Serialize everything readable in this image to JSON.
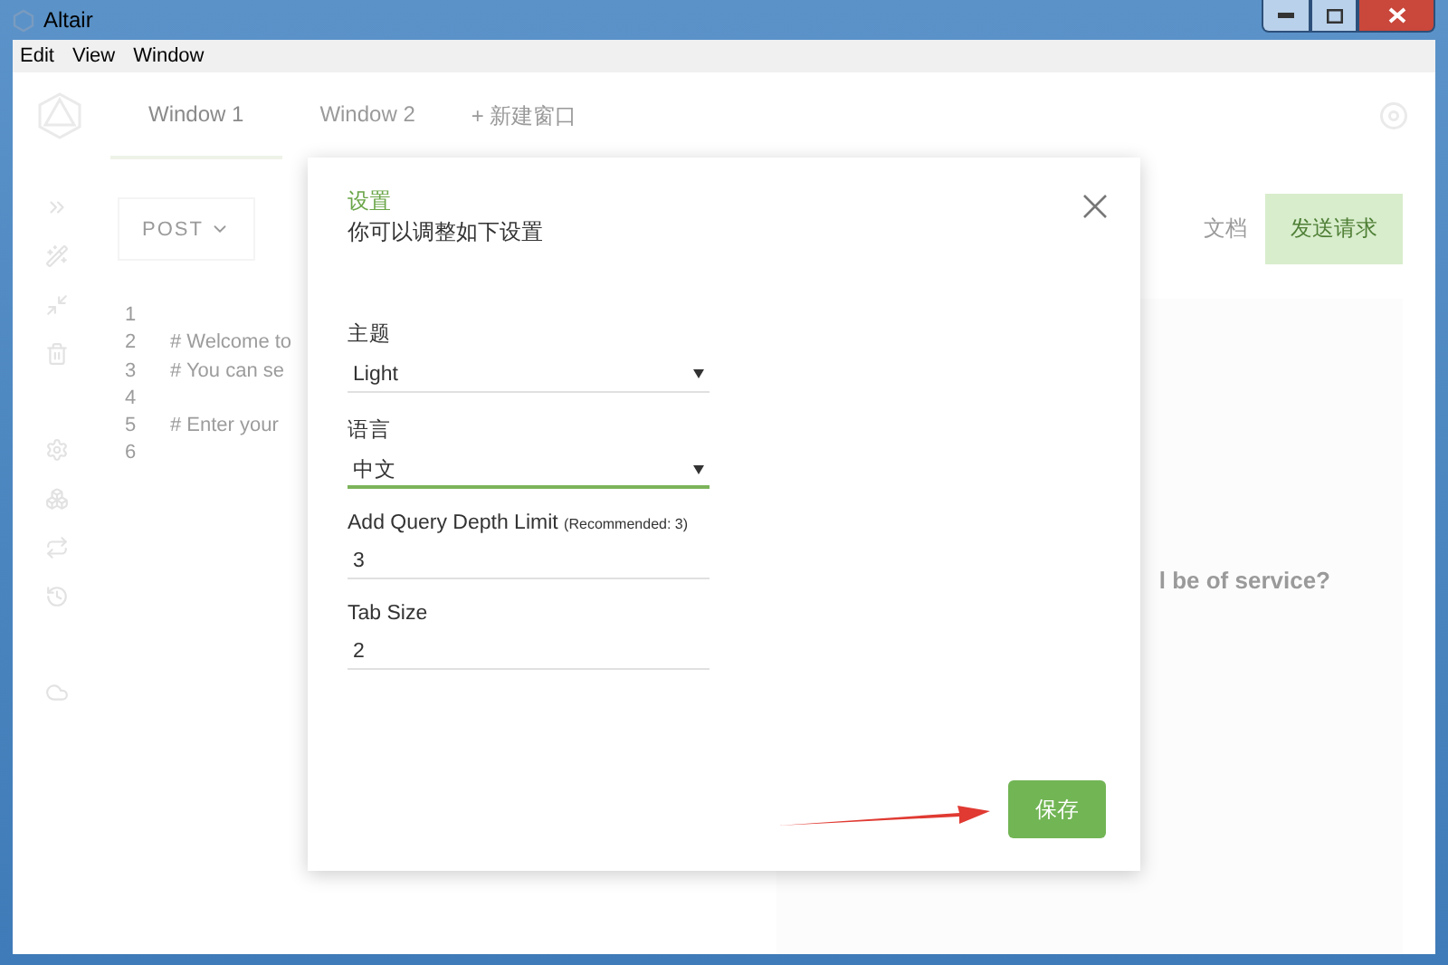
{
  "window": {
    "title": "Altair",
    "menu": [
      "Edit",
      "View",
      "Window"
    ]
  },
  "tabs": [
    {
      "label": "Window 1",
      "selected": true
    },
    {
      "label": "Window 2",
      "selected": false
    }
  ],
  "new_window_button": "+ 新建窗口",
  "toolbar": {
    "method": "POST",
    "docs": "文档",
    "send": "发送请求"
  },
  "editor": {
    "lines": [
      {
        "number": "1"
      },
      {
        "number": "2",
        "text": "# Welcome to"
      },
      {
        "number": "3",
        "text": "# You can se"
      },
      {
        "number": "4"
      },
      {
        "number": "5",
        "text": "# Enter your"
      },
      {
        "number": "6"
      }
    ]
  },
  "result_panel": {
    "message": "l be of service?"
  },
  "dialog": {
    "title": "设置",
    "subtitle": "你可以调整如下设置",
    "fields": [
      {
        "kind": "select",
        "label": "主题",
        "value": "Light",
        "focused": false
      },
      {
        "kind": "select",
        "label": "语言",
        "value": "中文",
        "focused": true
      },
      {
        "kind": "number",
        "label": "Add Query Depth Limit",
        "hint": "(Recommended: 3)",
        "value": "3",
        "focused": false
      },
      {
        "kind": "number",
        "label": "Tab Size",
        "value": "2",
        "focused": false
      }
    ],
    "save_button": "保存"
  }
}
